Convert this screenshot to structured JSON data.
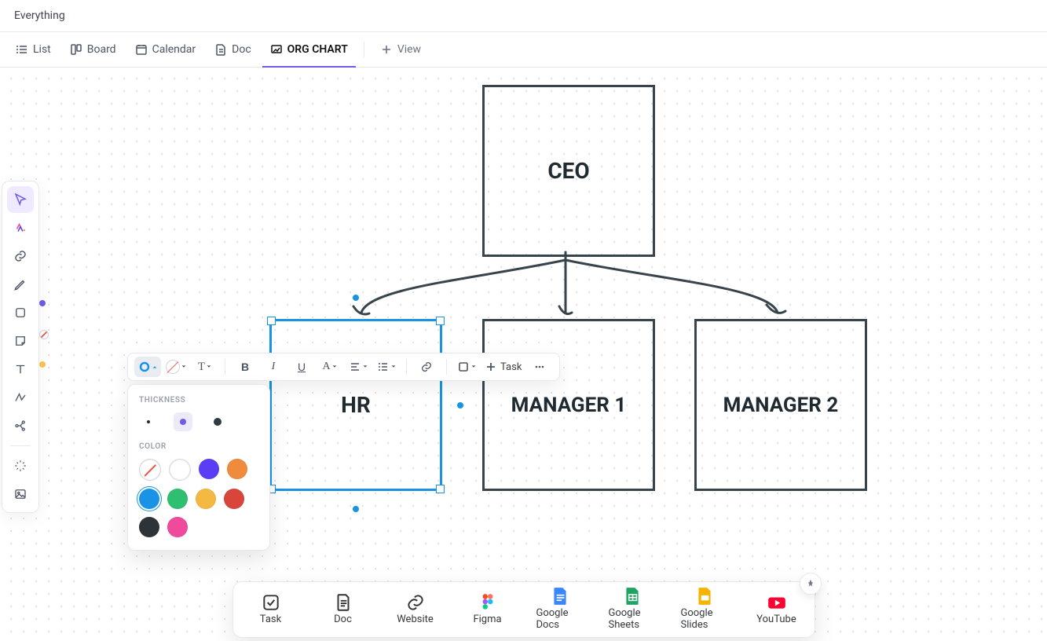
{
  "header": {
    "title": "Everything"
  },
  "tabs": {
    "list": "List",
    "board": "Board",
    "calendar": "Calendar",
    "doc": "Doc",
    "orgchart": "ORG CHART",
    "addview": "View"
  },
  "toolbar": {
    "task_label": "Task"
  },
  "popover": {
    "thickness_label": "THICKNESS",
    "color_label": "COLOR",
    "thickness_selected": "medium",
    "colors": {
      "none": "none",
      "white": "#ffffff",
      "indigo": "#5b3df5",
      "orange": "#f08a3c",
      "blue": "#1893e6",
      "green": "#2fbf71",
      "yellow": "#f4b942",
      "red": "#d9453a",
      "black": "#2e3338",
      "pink": "#ef4a9c"
    },
    "color_selected": "blue"
  },
  "chart": {
    "ceo": "CEO",
    "hr": "HR",
    "m1": "MANAGER 1",
    "m2": "MANAGER 2"
  },
  "dock": {
    "task": "Task",
    "doc": "Doc",
    "website": "Website",
    "figma": "Figma",
    "gdocs": "Google Docs",
    "gsheets": "Google Sheets",
    "gslides": "Google Slides",
    "youtube": "YouTube"
  }
}
